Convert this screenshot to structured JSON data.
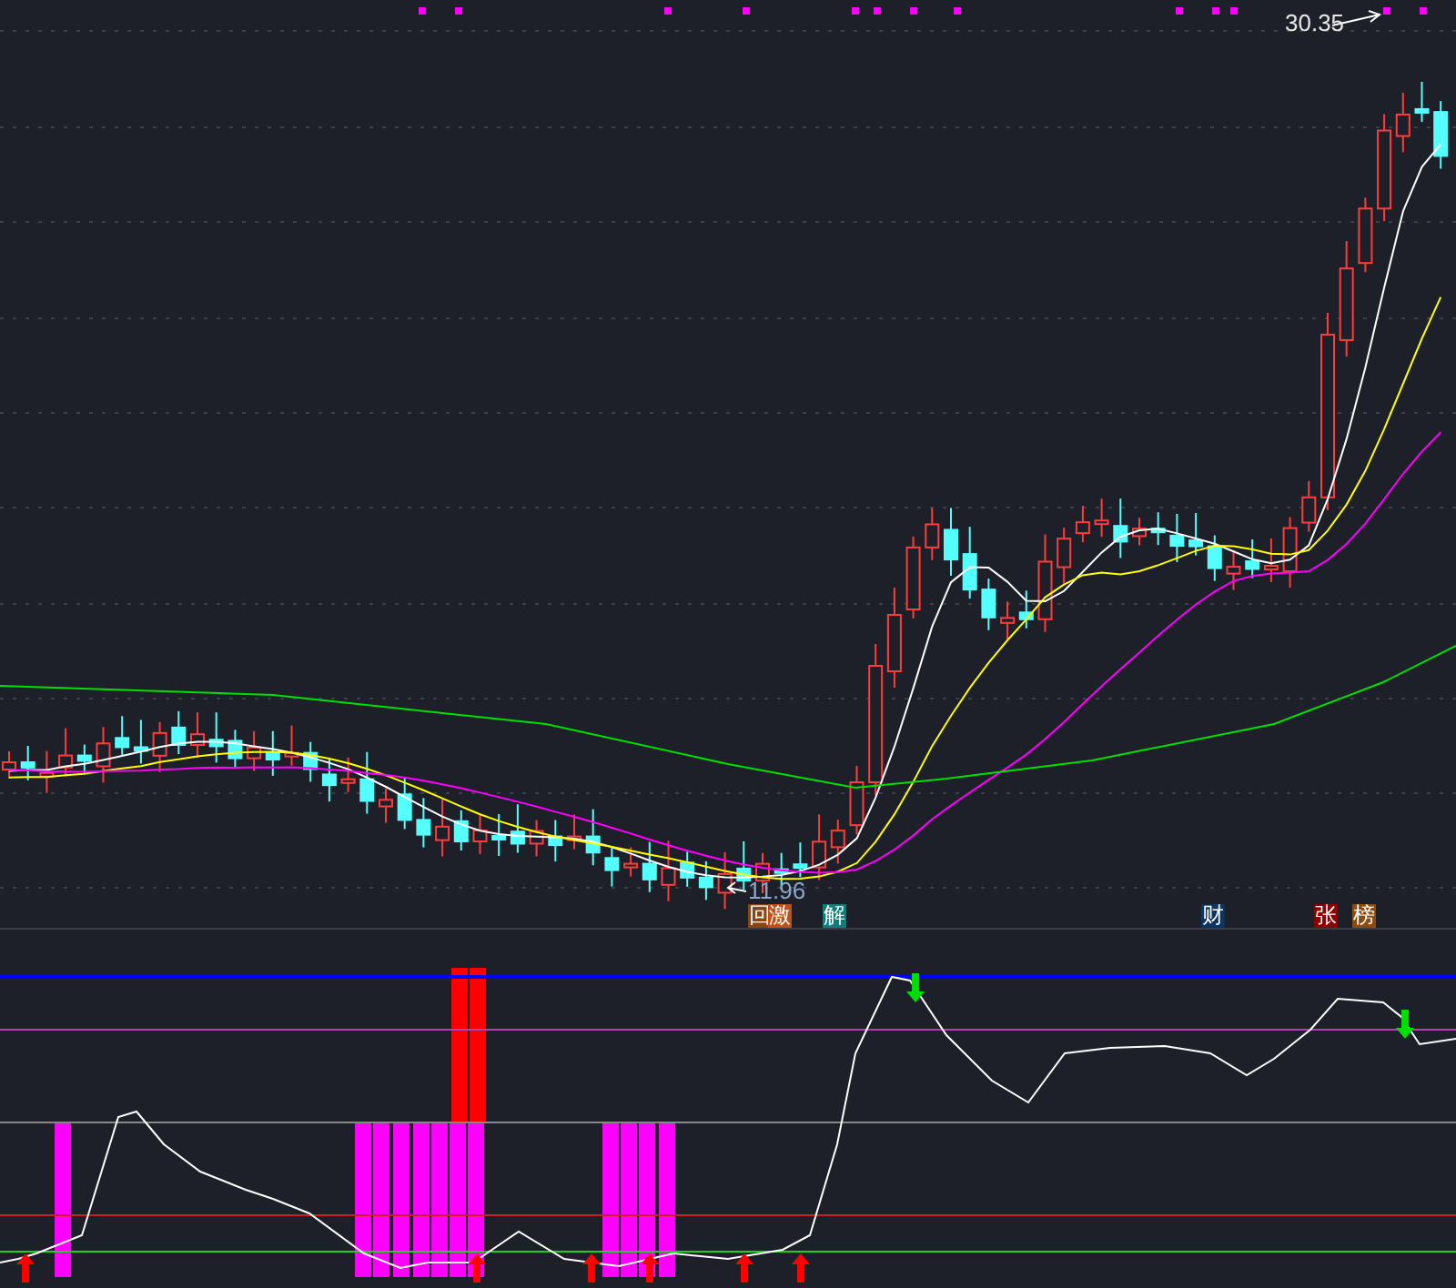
{
  "price_panel": {
    "high_label": "30.35",
    "low_label": "11.96",
    "signals": [
      {
        "text": "回",
        "color": "#8b4513"
      },
      {
        "text": "激",
        "color": "#c0501a"
      },
      {
        "text": "解",
        "color": "#0e7c7b"
      },
      {
        "text": "财",
        "color": "#0b3463"
      },
      {
        "text": "张",
        "color": "#8b0000"
      },
      {
        "text": "榜",
        "color": "#8b4a10"
      }
    ]
  }
}
